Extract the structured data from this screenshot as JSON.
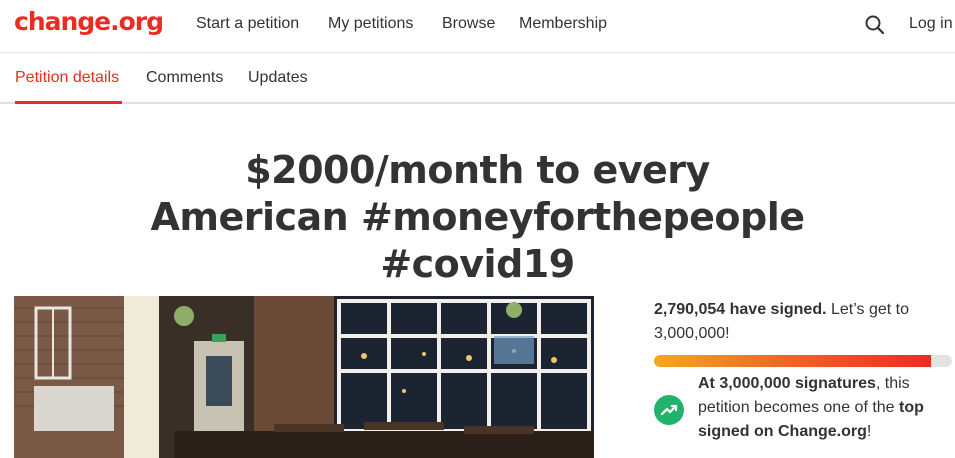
{
  "nav": {
    "logo": "change.org",
    "links": [
      "Start a petition",
      "My petitions",
      "Browse",
      "Membership"
    ],
    "login": "Log in"
  },
  "tabs": [
    "Petition details",
    "Comments",
    "Updates"
  ],
  "petition": {
    "title": "$2000/month to every American #moneyforthepeople #covid19"
  },
  "progress": {
    "signed_count": "2,790,054 have signed.",
    "cta": " Let’s get to 3,000,000!",
    "fraction": 0.93,
    "milestone_bold": "At 3,000,000 signatures",
    "milestone_mid": ", this petition becomes one of the ",
    "milestone_bold2": "top signed on Change.org",
    "milestone_end": "!"
  },
  "colors": {
    "brand": "#ec2c22",
    "success": "#21b26b"
  }
}
